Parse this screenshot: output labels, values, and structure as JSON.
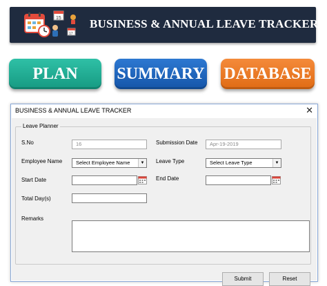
{
  "banner": {
    "title": "BUSINESS & ANNUAL LEAVE TRACKER",
    "icon": "calendar-clock-icon"
  },
  "nav": {
    "plan": "PLAN",
    "summary": "SUMMARY",
    "database": "DATABASE"
  },
  "colors": {
    "banner_bg": "#1f2b3f",
    "plan": "#1fae94",
    "summary": "#1f67bf",
    "database": "#ec7a24"
  },
  "dialog": {
    "title": "BUSINESS & ANNUAL LEAVE TRACKER",
    "close": "✕",
    "frame_label": "Leave Planner",
    "labels": {
      "sno": "S.No",
      "submission_date": "Submission Date",
      "employee_name": "Employee Name",
      "leave_type": "Leave Type",
      "start_date": "Start Date",
      "end_date": "End Date",
      "total_days": "Total Day(s)",
      "remarks": "Remarks"
    },
    "values": {
      "sno": "16",
      "submission_date": "Apr-19-2019",
      "employee_name": "Select Employee Name",
      "leave_type": "Select Leave Type",
      "start_date": "",
      "end_date": "",
      "total_days": "",
      "remarks": ""
    },
    "buttons": {
      "submit": "Submit",
      "reset": "Reset"
    }
  }
}
